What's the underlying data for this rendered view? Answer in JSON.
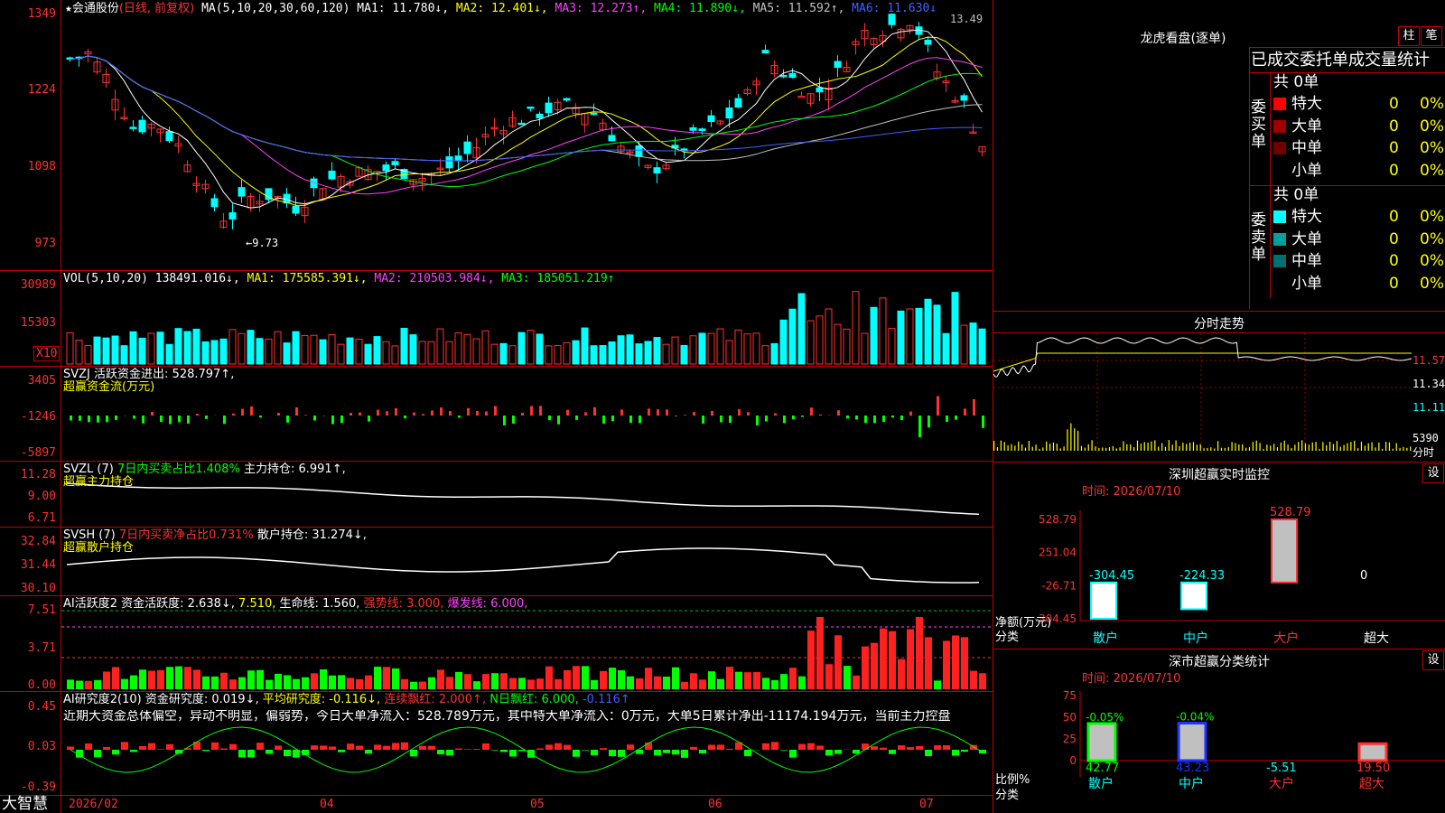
{
  "stock": {
    "name": "会通股份",
    "mode": "(日线, 前复权)",
    "ma_label": "MA(5,10,20,30,60,120)",
    "ma": [
      {
        "label": "MA1: 11.780↓,",
        "color": "#ffffff"
      },
      {
        "label": "MA2: 12.401↓,",
        "color": "#ffff00"
      },
      {
        "label": "MA3: 12.273↑,",
        "color": "#ff40ff"
      },
      {
        "label": "MA4: 11.890↓,",
        "color": "#00ff00"
      },
      {
        "label": "MA5: 11.592↑,",
        "color": "#c0c0c0"
      },
      {
        "label": "MA6: 11.630↓",
        "color": "#4060ff"
      }
    ],
    "high_mark": "13.49",
    "low_mark": "←9.73",
    "price_axis": [
      "1349",
      "1224",
      "1098",
      "973"
    ]
  },
  "vol": {
    "label": "VOL(5,10,20)",
    "value": "138491.016↓,",
    "ma1": "MA1: 175585.391↓,",
    "ma2": "MA2: 210503.984↓,",
    "ma3": "MA3: 185051.219↑",
    "axis": [
      "30989",
      "15303"
    ],
    "unit": "X10"
  },
  "svzj": {
    "label": "SVZJ",
    "text": "活跃资金进出: 528.797↑,",
    "sub": "超赢资金流(万元)",
    "axis": [
      "3405",
      "-1246",
      "-5897"
    ]
  },
  "svzl": {
    "label": "SVZL (7)",
    "text1": "7日内买卖占比1.408%",
    "text2": "主力持仓: 6.991↑,",
    "sub": "超赢主力持仓",
    "axis": [
      "11.28",
      "9.00",
      "6.71"
    ]
  },
  "svsh": {
    "label": "SVSH (7)",
    "text1": "7日内买卖净占比0.731%",
    "text2": "散户持仓: 31.274↓,",
    "sub": "超赢散户持仓",
    "axis": [
      "32.84",
      "31.44",
      "30.10"
    ]
  },
  "ai1": {
    "label": "AI活跃度2",
    "t1": "资金活跃度: 2.638↓,",
    "t2": "7.510,",
    "t3": "生命线: 1.560,",
    "t4": "强势线: 3.000,",
    "t5": "爆发线: 6.000,",
    "axis": [
      "7.51",
      "3.71",
      "0.00"
    ]
  },
  "ai2": {
    "label": "AI研究度2(10)",
    "t1": "资金研究度: 0.019↓,",
    "t2": "平均研究度: -0.116↓,",
    "t3": "连续飘红: 2.000↑,",
    "t4": "N日飘红: 6.000,",
    "t5": "-0.116↑",
    "comment": "近期大资金总体偏空，异动不明显，偏弱势，今日大单净流入：528.789万元，其中特大单净流入：0万元，大单5日累计净出-11174.194万元，当前主力控盘",
    "axis": [
      "0.45",
      "0.03",
      "-0.39"
    ]
  },
  "time_axis": {
    "logo": "大智慧",
    "labels": [
      "2026/02",
      "04",
      "05",
      "06",
      "07"
    ]
  },
  "dragon": {
    "title": "龙虎看盘(逐单)",
    "btn1": "柱",
    "btn2": "笔",
    "header": "已成交委托单成交量统计",
    "buy_label": "委买单",
    "sell_label": "委卖单",
    "buy_total": "共 0单",
    "sell_total": "共 0单",
    "buy_rows": [
      {
        "name": "特大",
        "count": "0",
        "pct": "0%",
        "color": "#ff0000"
      },
      {
        "name": "大单",
        "count": "0",
        "pct": "0%",
        "color": "#a00000"
      },
      {
        "name": "中单",
        "count": "0",
        "pct": "0%",
        "color": "#700000"
      },
      {
        "name": "小单",
        "count": "0",
        "pct": "0%",
        "color": "#000000"
      }
    ],
    "sell_rows": [
      {
        "name": "特大",
        "count": "0",
        "pct": "0%",
        "color": "#00ffff"
      },
      {
        "name": "大单",
        "count": "0",
        "pct": "0%",
        "color": "#00a0a0"
      },
      {
        "name": "中单",
        "count": "0",
        "pct": "0%",
        "color": "#007070"
      },
      {
        "name": "小单",
        "count": "0",
        "pct": "0%",
        "color": "#000000"
      }
    ]
  },
  "intraday": {
    "title": "分时走势",
    "axis": [
      "11.57",
      "11.34",
      "11.11"
    ],
    "vol_label": "5390",
    "unit": "分时"
  },
  "monitor": {
    "title": "深圳超赢实时监控",
    "set": "设",
    "time": "时间: 2026/07/10",
    "axis": [
      "528.79",
      "251.04",
      "-26.71",
      "-304.45"
    ],
    "ylabel": "净额(万元)",
    "xlabel": "分类",
    "bars": [
      {
        "cat": "散户",
        "value": -304.45,
        "label": "-304.45",
        "color": "#00ffff"
      },
      {
        "cat": "中户",
        "value": -224.33,
        "label": "-224.33",
        "color": "#00ffff"
      },
      {
        "cat": "大户",
        "value": 528.79,
        "label": "528.79",
        "color": "#ff3030"
      },
      {
        "cat": "超大",
        "value": 0,
        "label": "0",
        "color": "#ffffff"
      }
    ]
  },
  "classify": {
    "title": "深市超赢分类统计",
    "set": "设",
    "time": "时间: 2026/07/10",
    "axis": [
      "75",
      "50",
      "25",
      "0"
    ],
    "ylabel": "比例%",
    "xlabel": "分类",
    "bars": [
      {
        "cat": "散户",
        "value": 42.77,
        "label": "42.77",
        "top": "-0.05%",
        "color": "#00ff00"
      },
      {
        "cat": "中户",
        "value": 43.23,
        "label": "43.23",
        "top": "-0.04%",
        "color": "#2030ff"
      },
      {
        "cat": "大户",
        "value": -5.51,
        "label": "-5.51",
        "top": "",
        "color": "#00ffff"
      },
      {
        "cat": "超大",
        "value": 19.5,
        "label": "19.50",
        "top": "",
        "color": "#ff3030"
      }
    ]
  }
}
